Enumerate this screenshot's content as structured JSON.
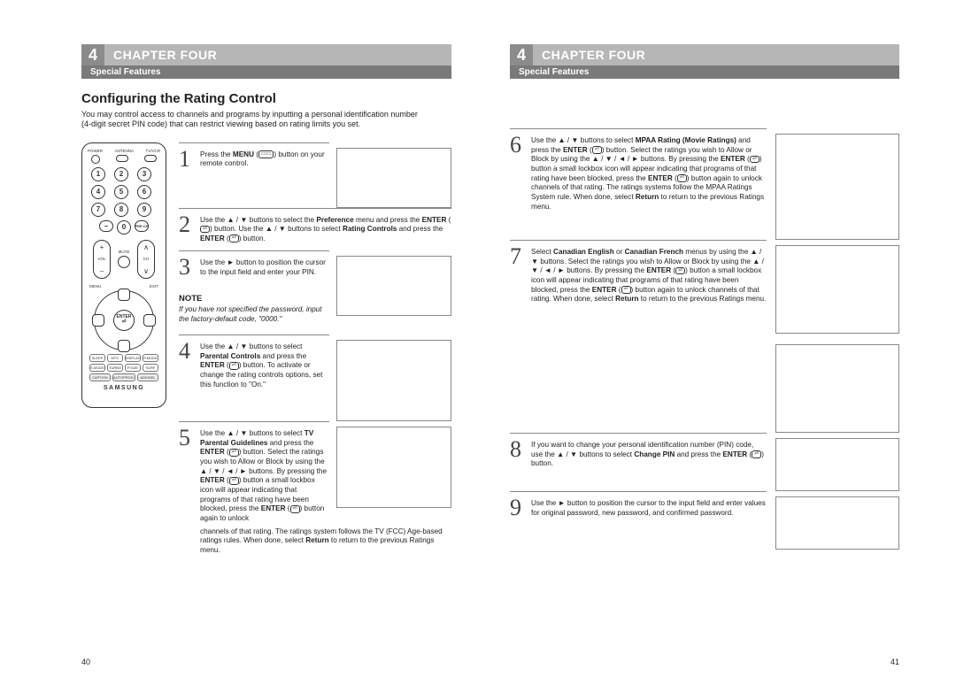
{
  "chapter": {
    "number": "4",
    "title": "CHAPTER FOUR",
    "subtitle": "Special Features"
  },
  "section": {
    "title": "Configuring the Rating Control",
    "intro": "You may control access to channels and programs by inputting a personal identification number (4-digit secret PIN code) that can restrict viewing based on rating limits you set."
  },
  "remote": {
    "power": "POWER",
    "antenna": "ANTENNA",
    "tvvcr": "TV/VCR",
    "vol": "VOL",
    "ch": "CH",
    "mute": "MUTE",
    "prech": "PRE.CH",
    "menu": "MENU",
    "exit": "EXIT",
    "enter": "ENTER",
    "brand": "SAMSUNG",
    "row_a": [
      "SLEEP",
      "MTS",
      "DISPLAY",
      "P.MODE"
    ],
    "row_b": [
      "S.MODE",
      "TURBO",
      "P.SIZE",
      "SURF"
    ],
    "row_c": [
      "CAPTION",
      "AUTOPROG.",
      "ADD/DEL"
    ]
  },
  "icons": {
    "menu_pill": "▭▭",
    "enter_pill": "⏎"
  },
  "note": {
    "label": "NOTE",
    "text": "If you have not specified the password, input the factory-default code, \"0000.\""
  },
  "steps_left": [
    {
      "n": "1",
      "html": "Press the <b>MENU</b> (<span class='icon-pill'>▭▭</span>) button on your remote control."
    },
    {
      "n": "2",
      "html": "Use the ▲ / ▼ buttons to select the <b>Preference</b> menu and press the <b>ENTER</b> (<span class='icon-pill'>⏎</span>) button. Use the ▲ / ▼ buttons to select <b>Rating Controls</b> and press the <b>ENTER</b> (<span class='icon-pill'>⏎</span>) button."
    },
    {
      "n": "3",
      "html": "Use the ► button to position the cursor to the input field and enter your PIN."
    },
    {
      "n": "4",
      "html": "Use the ▲ / ▼ buttons to select <b>Parental Controls</b> and press the <b>ENTER</b> (<span class='icon-pill'>⏎</span>) button. To activate or change the rating controls options, set this function to \"On.\""
    },
    {
      "n": "5",
      "html": "Use the ▲ / ▼ buttons to select <b>TV Parental Guidelines</b> and press the <b>ENTER</b> (<span class='icon-pill'>⏎</span>) button. Select the ratings you wish to Allow or Block by using the ▲ / ▼ / ◄ / ► buttons. By pressing the <b>ENTER</b> (<span class='icon-pill'>⏎</span>) button a small lockbox icon will appear indicating that programs of that rating have been blocked, press the <b>ENTER</b> (<span class='icon-pill'>⏎</span>) button again to unlock",
      "cont": "channels of that rating. The ratings system follows the TV (FCC) Age-based ratings rules.  When done, select <b>Return</b> to return to the previous Ratings menu."
    }
  ],
  "steps_right": [
    {
      "n": "6",
      "html": "Use the ▲ / ▼ buttons to select <b>MPAA Rating (Movie Ratings)</b> and press the <b>ENTER</b> (<span class='icon-pill'>⏎</span>) button. Select the ratings you wish to Allow or Block by using the ▲ / ▼ / ◄ / ► buttons. By pressing the <b>ENTER</b> (<span class='icon-pill'>⏎</span>) button a small lockbox icon will appear indicating that programs of that rating have been blocked, press the <b>ENTER</b> (<span class='icon-pill'>⏎</span>) button again to unlock channels of that rating. The ratings systems follow the MPAA Ratings System rule. When done, select <b>Return</b> to return to the previous Ratings menu."
    },
    {
      "n": "7",
      "html": "Select <b>Canadian English</b> or <b>Canadian French</b> menus by using the ▲ / ▼ buttons. Select the ratings you wish to Allow or Block by using the ▲ / ▼ / ◄ / ► buttons. By pressing the <b>ENTER</b> (<span class='icon-pill'>⏎</span>) button a small lockbox icon will appear indicating that programs of that rating have been blocked, press the <b>ENTER</b> (<span class='icon-pill'>⏎</span>) button again to unlock channels of that rating. When done, select <b>Return</b> to return to the previous Ratings menu."
    },
    {
      "n": "8",
      "html": "If you want to change your personal identification number (PIN) code, use the ▲ / ▼ buttons to select <b>Change PIN</b> and press the <b>ENTER</b> (<span class='icon-pill'>⏎</span>) button."
    },
    {
      "n": "9",
      "html": "Use the ► button to position the cursor to the input field and enter values for original password, new password, and confirmed password."
    }
  ],
  "pagenum": {
    "left": "40",
    "right": "41"
  }
}
